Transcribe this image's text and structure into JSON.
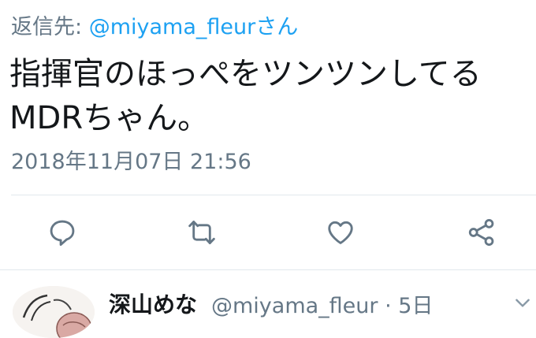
{
  "reply": {
    "prefix": "返信先:",
    "handle": "@miyama_fleurさん"
  },
  "tweet": {
    "line1": "指揮官のほっぺをツンツンしてる",
    "line2": "MDRちゃん。",
    "timestamp": "2018年11月07日 21:56"
  },
  "actions": [
    "reply-icon",
    "retweet-icon",
    "like-icon",
    "share-icon"
  ],
  "next_tweet": {
    "name": "深山めな",
    "handle": "@miyama_fleur",
    "separator": "·",
    "age": "5日"
  },
  "colors": {
    "accent": "#1da1f2",
    "secondary": "#657786",
    "text": "#14171a",
    "divider": "#e1e8ed"
  }
}
